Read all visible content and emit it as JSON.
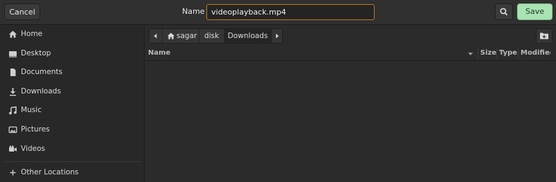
{
  "header": {
    "cancel_label": "Cancel",
    "name_label": "Name",
    "name_value": "videoplayback.mp4",
    "save_label": "Save"
  },
  "sidebar": {
    "items": [
      {
        "label": "Home",
        "icon": "home-icon"
      },
      {
        "label": "Desktop",
        "icon": "desktop-icon"
      },
      {
        "label": "Documents",
        "icon": "document-icon"
      },
      {
        "label": "Downloads",
        "icon": "download-icon"
      },
      {
        "label": "Music",
        "icon": "music-icon"
      },
      {
        "label": "Pictures",
        "icon": "picture-icon"
      },
      {
        "label": "Videos",
        "icon": "video-icon"
      },
      {
        "label": "Other Locations",
        "icon": "plus-icon"
      }
    ]
  },
  "pathbar": {
    "segments": [
      "sagar",
      "disk",
      "Downloads"
    ],
    "active": "Downloads"
  },
  "columns": [
    "Name",
    "Size",
    "Type",
    "Modified"
  ],
  "colors": {
    "accent_focus": "#c07a25",
    "save_bg": "#a9e2b3",
    "window_bg": "#2b2b2b"
  }
}
